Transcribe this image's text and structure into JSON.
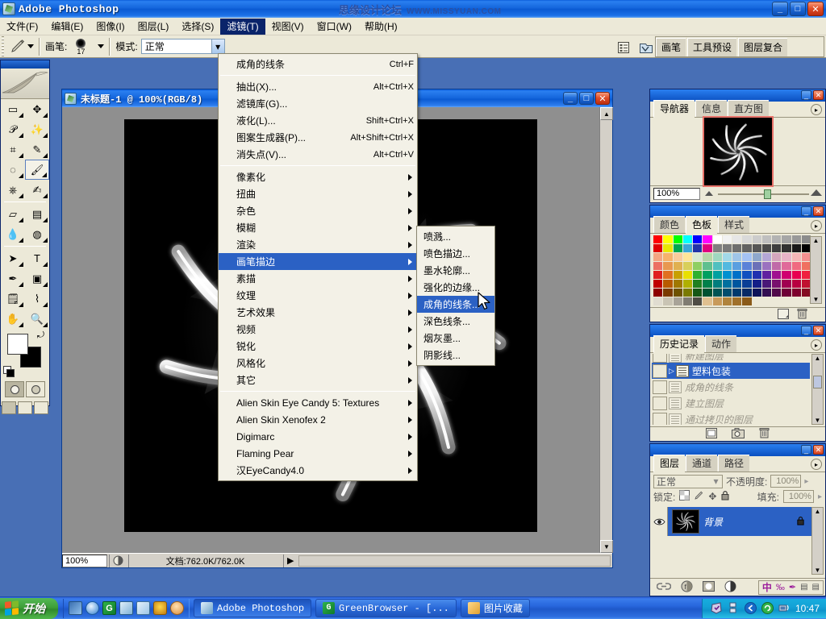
{
  "window": {
    "title": "Adobe Photoshop",
    "watermark_cn": "思缘设计论坛",
    "watermark_en": "WWW.MISSYUAN.COM",
    "minimize": "_",
    "maximize": "□",
    "close": "✕"
  },
  "menubar": [
    {
      "label": "文件(F)",
      "active": false
    },
    {
      "label": "编辑(E)",
      "active": false
    },
    {
      "label": "图像(I)",
      "active": false
    },
    {
      "label": "图层(L)",
      "active": false
    },
    {
      "label": "选择(S)",
      "active": false
    },
    {
      "label": "滤镜(T)",
      "active": true
    },
    {
      "label": "视图(V)",
      "active": false
    },
    {
      "label": "窗口(W)",
      "active": false
    },
    {
      "label": "帮助(H)",
      "active": false
    }
  ],
  "options_bar": {
    "brush_label": "画笔:",
    "brush_size": "17",
    "mode_label": "模式:",
    "mode_value": "正常",
    "palette_tabs": [
      "画笔",
      "工具预设",
      "图层复合"
    ]
  },
  "filter_menu": {
    "groups": [
      [
        {
          "label": "成角的线条",
          "accel": "Ctrl+F",
          "submenu": false,
          "selected": false
        }
      ],
      [
        {
          "label": "抽出(X)...",
          "accel": "Alt+Ctrl+X",
          "submenu": false,
          "selected": false
        },
        {
          "label": "滤镜库(G)...",
          "accel": "",
          "submenu": false,
          "selected": false
        },
        {
          "label": "液化(L)...",
          "accel": "Shift+Ctrl+X",
          "submenu": false,
          "selected": false
        },
        {
          "label": "图案生成器(P)...",
          "accel": "Alt+Shift+Ctrl+X",
          "submenu": false,
          "selected": false
        },
        {
          "label": "消失点(V)...",
          "accel": "Alt+Ctrl+V",
          "submenu": false,
          "selected": false
        }
      ],
      [
        {
          "label": "像素化",
          "accel": "",
          "submenu": true,
          "selected": false
        },
        {
          "label": "扭曲",
          "accel": "",
          "submenu": true,
          "selected": false
        },
        {
          "label": "杂色",
          "accel": "",
          "submenu": true,
          "selected": false
        },
        {
          "label": "模糊",
          "accel": "",
          "submenu": true,
          "selected": false
        },
        {
          "label": "渲染",
          "accel": "",
          "submenu": true,
          "selected": false
        },
        {
          "label": "画笔描边",
          "accel": "",
          "submenu": true,
          "selected": true
        },
        {
          "label": "素描",
          "accel": "",
          "submenu": true,
          "selected": false
        },
        {
          "label": "纹理",
          "accel": "",
          "submenu": true,
          "selected": false
        },
        {
          "label": "艺术效果",
          "accel": "",
          "submenu": true,
          "selected": false
        },
        {
          "label": "视频",
          "accel": "",
          "submenu": true,
          "selected": false
        },
        {
          "label": "锐化",
          "accel": "",
          "submenu": true,
          "selected": false
        },
        {
          "label": "风格化",
          "accel": "",
          "submenu": true,
          "selected": false
        },
        {
          "label": "其它",
          "accel": "",
          "submenu": true,
          "selected": false
        }
      ],
      [
        {
          "label": "Alien Skin Eye Candy 5: Textures",
          "accel": "",
          "submenu": true,
          "selected": false
        },
        {
          "label": "Alien Skin Xenofex 2",
          "accel": "",
          "submenu": true,
          "selected": false
        },
        {
          "label": "Digimarc",
          "accel": "",
          "submenu": true,
          "selected": false
        },
        {
          "label": "Flaming Pear",
          "accel": "",
          "submenu": true,
          "selected": false
        },
        {
          "label": "汉EyeCandy4.0",
          "accel": "",
          "submenu": true,
          "selected": false
        }
      ]
    ]
  },
  "filter_submenu": {
    "items": [
      {
        "label": "喷溅...",
        "selected": false
      },
      {
        "label": "喷色描边...",
        "selected": false
      },
      {
        "label": "墨水轮廓...",
        "selected": false
      },
      {
        "label": "强化的边缘...",
        "selected": false
      },
      {
        "label": "成角的线条...",
        "selected": true
      },
      {
        "label": "深色线条...",
        "selected": false
      },
      {
        "label": "烟灰墨...",
        "selected": false
      },
      {
        "label": "阴影线...",
        "selected": false
      }
    ]
  },
  "document": {
    "title": "未标题-1 @ 100%(RGB/8)",
    "zoom": "100%",
    "status": "文档:762.0K/762.0K",
    "minimize": "_",
    "maximize": "□",
    "close": "✕"
  },
  "navigator": {
    "tabs": [
      "导航器",
      "信息",
      "直方图"
    ],
    "active_tab": "导航器",
    "zoom": "100%"
  },
  "color_panel": {
    "tabs": [
      "颜色",
      "色板",
      "样式"
    ],
    "active_tab": "色板",
    "swatch_rows": [
      [
        "#ff0000",
        "#ffff00",
        "#00ff00",
        "#00ffff",
        "#0000ff",
        "#ff00ff",
        "#ffffff",
        "#f2f2f2",
        "#e6e6e6",
        "#d9d9d9",
        "#cccccc",
        "#bfbfbf",
        "#b3b3b3",
        "#a6a6a6",
        "#999999",
        "#8c8c8c"
      ],
      [
        "#e00000",
        "#e8e800",
        "#00a651",
        "#3aa6d8",
        "#2233aa",
        "#e0007f",
        "#808080",
        "#7a7a7a",
        "#6e6e6e",
        "#626262",
        "#565656",
        "#4a4a4a",
        "#3e3e3e",
        "#323232",
        "#191919",
        "#000000"
      ],
      [
        "#f4a582",
        "#f6b26b",
        "#f9cb9c",
        "#ffe599",
        "#d9ead3",
        "#b6d7a8",
        "#9fd8c0",
        "#a2d9e8",
        "#9fc5e8",
        "#a4c2f4",
        "#8fa8cc",
        "#b4a7d6",
        "#d5a6bd",
        "#e8b4c8",
        "#f4b6b6",
        "#f49090"
      ],
      [
        "#ec7063",
        "#e8984f",
        "#e0b050",
        "#d8cf5a",
        "#8fcf63",
        "#5fc08f",
        "#4fc0c0",
        "#53b9e0",
        "#5a9fe0",
        "#5b82d8",
        "#6b70b8",
        "#9b72c0",
        "#c06aa8",
        "#e06a9a",
        "#f06a80",
        "#f07060"
      ],
      [
        "#e02020",
        "#e07020",
        "#c8a000",
        "#e8e000",
        "#30b030",
        "#009f60",
        "#00a0a0",
        "#0090d0",
        "#0070c8",
        "#1050c0",
        "#2030b0",
        "#6020a0",
        "#a01090",
        "#d00070",
        "#e80050",
        "#f02040"
      ],
      [
        "#c00000",
        "#b85a00",
        "#a07800",
        "#b0b000",
        "#208020",
        "#00804a",
        "#007d7d",
        "#00709f",
        "#00569f",
        "#0a3e96",
        "#141e88",
        "#4a1878",
        "#78106e",
        "#a00050",
        "#b80040",
        "#c01030"
      ],
      [
        "#8c0000",
        "#7a3a00",
        "#6e5200",
        "#7a7a00",
        "#165816",
        "#005232",
        "#005454",
        "#004d6e",
        "#003a6e",
        "#062a66",
        "#0e1459",
        "#330f52",
        "#51094a",
        "#6e0037",
        "#7d002c",
        "#840b22"
      ],
      [
        "#e0dcd0",
        "#c9c4b4",
        "#a8a398",
        "#807c72",
        "#4f4c44",
        "#e0c090",
        "#c89a5a",
        "#b0833c",
        "#a0702a",
        "#8a5a18",
        "",
        "",
        "",
        "",
        "",
        ""
      ]
    ]
  },
  "history_panel": {
    "tabs": [
      "历史记录",
      "动作"
    ],
    "active_tab": "历史记录",
    "items": [
      {
        "label": "新建图层",
        "selected": false,
        "dim": true,
        "partial": true
      },
      {
        "label": "塑料包装",
        "selected": true,
        "dim": false,
        "partial": false
      },
      {
        "label": "成角的线条",
        "selected": false,
        "dim": true,
        "partial": false
      },
      {
        "label": "建立图层",
        "selected": false,
        "dim": true,
        "partial": false
      },
      {
        "label": "通过拷贝的图层",
        "selected": false,
        "dim": true,
        "partial": false
      }
    ]
  },
  "layers_panel": {
    "tabs": [
      "图层",
      "通道",
      "路径"
    ],
    "active_tab": "图层",
    "blend_mode": "正常",
    "opacity_label": "不透明度:",
    "opacity_value": "100%",
    "lock_label": "锁定:",
    "fill_label": "填充:",
    "fill_value": "100%",
    "layers": [
      {
        "name": "背景",
        "selected": true,
        "visible": true,
        "locked": true
      }
    ]
  },
  "toolbox": {
    "tools": [
      {
        "name": "marquee-tool",
        "glyph": "▭"
      },
      {
        "name": "move-tool",
        "glyph": "✥"
      },
      {
        "name": "lasso-tool",
        "glyph": "𝒫"
      },
      {
        "name": "magic-wand-tool",
        "glyph": "✨"
      },
      {
        "name": "crop-tool",
        "glyph": "⌗"
      },
      {
        "name": "slice-tool",
        "glyph": "✎"
      },
      {
        "name": "healing-brush-tool",
        "glyph": "◌"
      },
      {
        "name": "brush-tool",
        "glyph": "🖌"
      },
      {
        "name": "clone-stamp-tool",
        "glyph": "⎈"
      },
      {
        "name": "history-brush-tool",
        "glyph": "✍"
      },
      {
        "name": "eraser-tool",
        "glyph": "▱"
      },
      {
        "name": "gradient-tool",
        "glyph": "▤"
      },
      {
        "name": "blur-tool",
        "glyph": "💧"
      },
      {
        "name": "dodge-tool",
        "glyph": "◍"
      },
      {
        "name": "path-selection-tool",
        "glyph": "➤"
      },
      {
        "name": "type-tool",
        "glyph": "T"
      },
      {
        "name": "pen-tool",
        "glyph": "✒"
      },
      {
        "name": "shape-tool",
        "glyph": "▣"
      },
      {
        "name": "notes-tool",
        "glyph": "🗒"
      },
      {
        "name": "eyedropper-tool",
        "glyph": "⌇"
      },
      {
        "name": "hand-tool",
        "glyph": "✋"
      },
      {
        "name": "zoom-tool",
        "glyph": "🔍"
      }
    ],
    "selected_tool": "brush-tool",
    "foreground_color": "#ffffff",
    "background_color": "#000000"
  },
  "taskbar": {
    "start_label": "开始",
    "buttons": [
      {
        "label": "Adobe Photoshop",
        "active": true,
        "icon": "photoshop-icon"
      },
      {
        "label": "GreenBrowser - [...",
        "active": false,
        "icon": "greenbrowser-icon"
      },
      {
        "label": "图片收藏",
        "active": false,
        "icon": "folder-icon"
      }
    ],
    "clock": "10:47"
  }
}
